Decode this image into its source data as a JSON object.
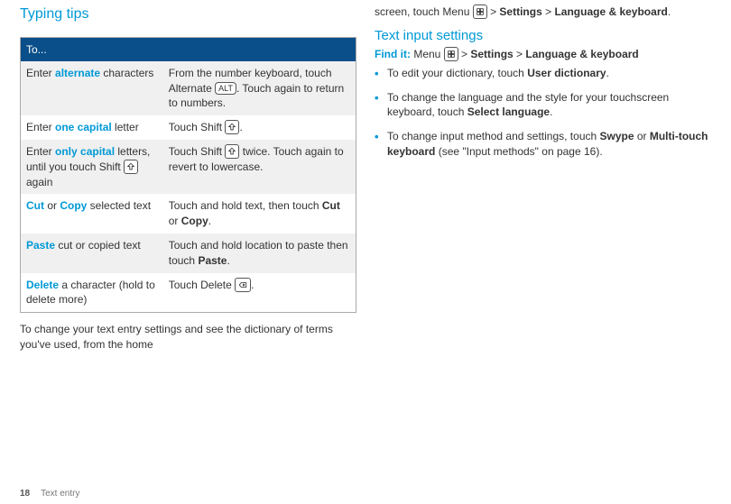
{
  "left": {
    "heading": "Typing tips",
    "table_header": "To...",
    "rows": [
      {
        "c1_pre": "Enter ",
        "c1_kw": "alternate",
        "c1_post": " characters",
        "c2_a": "From the number keyboard, touch Alternate ",
        "c2_key": "ALT",
        "c2_b": ". Touch again to return to numbers."
      },
      {
        "c1_pre": "Enter ",
        "c1_kw": "one capital",
        "c1_post": " letter",
        "c2_a": "Touch Shift ",
        "c2_key": "shift",
        "c2_b": "."
      },
      {
        "c1_pre": "Enter ",
        "c1_kw": "only capital",
        "c1_post": " letters, until you touch Shift ",
        "c1_key": "shift",
        "c1_tail": " again",
        "c2_a": "Touch Shift ",
        "c2_key": "shift",
        "c2_b": " twice. Touch again to revert to lowercase."
      },
      {
        "c1_kw": "Cut",
        "c1_mid": " or ",
        "c1_kw2": "Copy",
        "c1_post": " selected text",
        "c2_a": "Touch and hold text, then touch ",
        "c2_bold1": "Cut",
        "c2_mid": " or ",
        "c2_bold2": "Copy",
        "c2_b": "."
      },
      {
        "c1_kw": "Paste",
        "c1_post": " cut or copied text",
        "c2_a": "Touch and hold location to paste then touch ",
        "c2_bold1": "Paste",
        "c2_b": "."
      },
      {
        "c1_kw": "Delete",
        "c1_post": " a character (hold to delete more)",
        "c2_a": "Touch Delete ",
        "c2_key": "del",
        "c2_b": "."
      }
    ],
    "para": "To change your text entry settings and see the dictionary of terms you've used, from the home"
  },
  "right": {
    "top_a": "screen, touch Menu ",
    "top_b": " > ",
    "top_bold1": "Settings",
    "top_c": " > ",
    "top_bold2": "Language & keyboard",
    "top_d": ".",
    "heading": "Text input settings",
    "find_label": "Find it:",
    "find_a": " Menu ",
    "find_b": " > ",
    "find_bold1": "Settings",
    "find_c": " > ",
    "find_bold2": "Language & keyboard",
    "bullets": [
      {
        "a": "To edit your dictionary, touch ",
        "bold": "User dictionary",
        "b": "."
      },
      {
        "a": "To change the language and the style for your touchscreen keyboard, touch ",
        "bold": "Select language",
        "b": "."
      },
      {
        "a": "To change input method and settings, touch ",
        "bold": "Swype",
        "mid": " or ",
        "bold2": "Multi-touch keyboard",
        "b": " (see \"Input methods\" on page 16)."
      }
    ]
  },
  "footer": {
    "page": "18",
    "section": "Text entry"
  }
}
